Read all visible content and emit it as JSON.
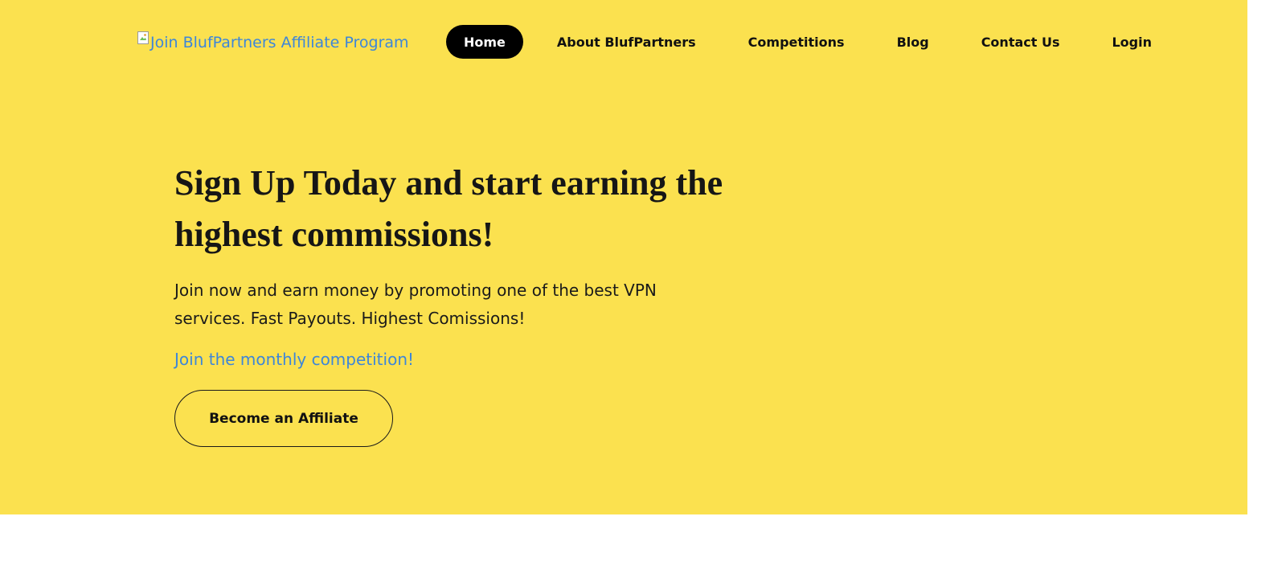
{
  "header": {
    "logo_alt": "Join BlufPartners Affiliate Program",
    "nav": [
      {
        "label": "Home",
        "active": true
      },
      {
        "label": "About BlufPartners",
        "active": false
      },
      {
        "label": "Competitions",
        "active": false
      },
      {
        "label": "Blog",
        "active": false
      },
      {
        "label": "Contact Us",
        "active": false
      },
      {
        "label": "Login",
        "active": false
      }
    ]
  },
  "hero": {
    "headline": "Sign Up Today and start earning the highest commissions!",
    "subtext": "Join now and earn money by promoting one of the best VPN services. Fast Payouts. Highest Comissions!",
    "competition_link": "Join the monthly competition!",
    "cta_label": "Become an Affiliate"
  },
  "colors": {
    "hero_background": "#fbe14f",
    "link": "#3d86d9",
    "active_nav_background": "#000000"
  },
  "icons": {
    "logo": "broken-image-icon"
  }
}
